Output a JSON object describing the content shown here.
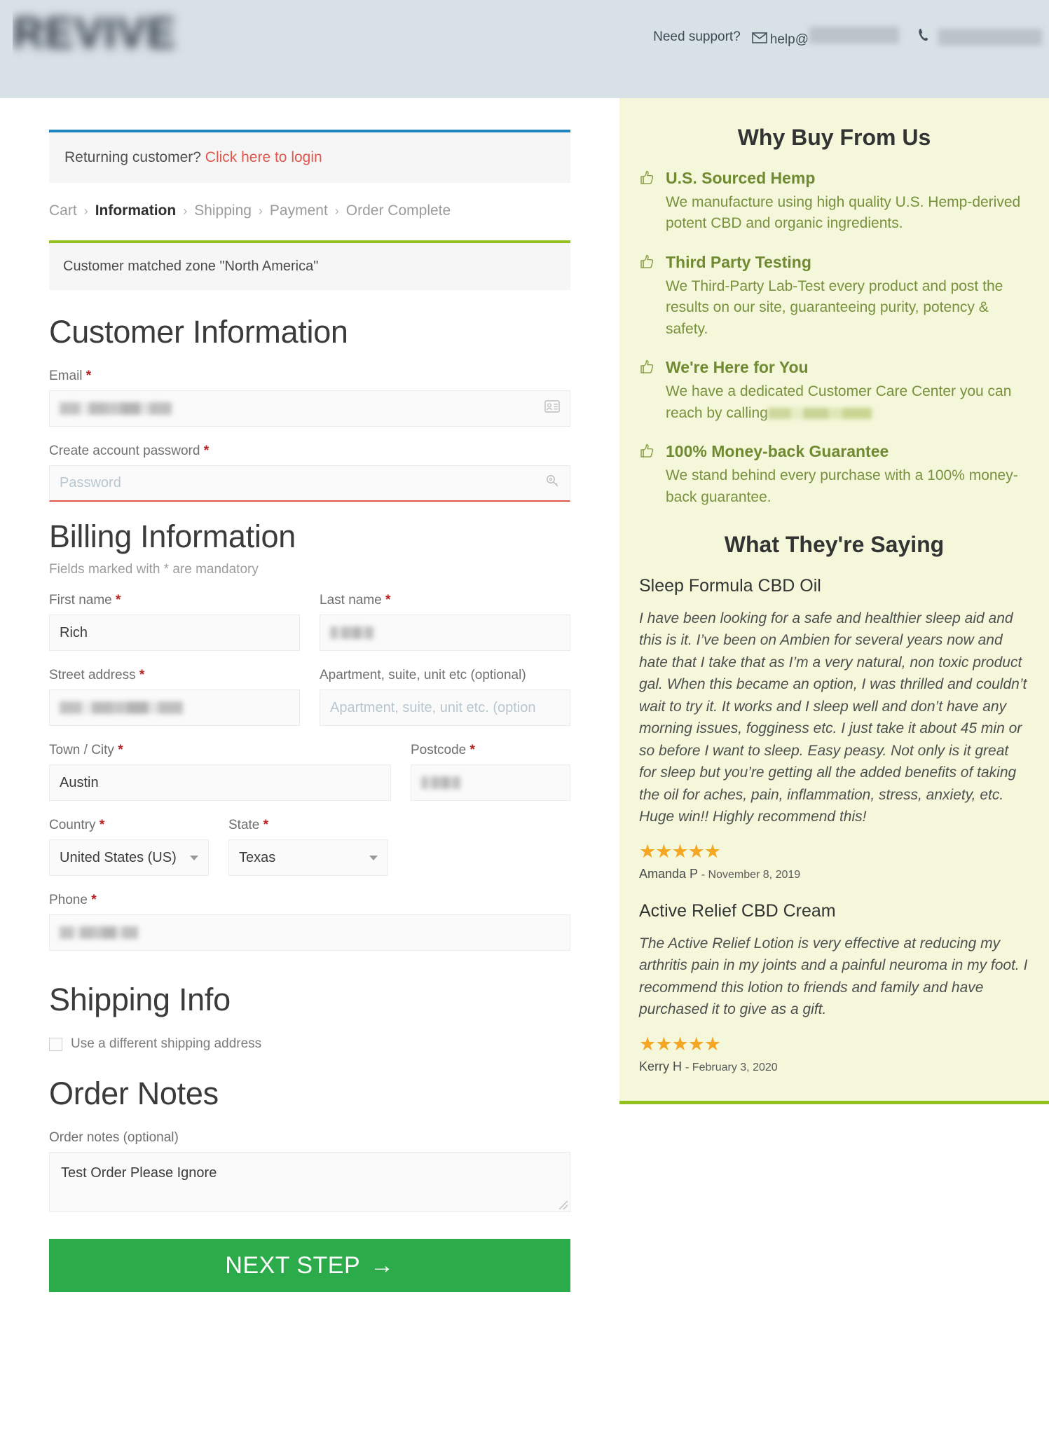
{
  "header": {
    "logo_alt": "brand-logo-redacted",
    "support_label": "Need support?",
    "email_prefix": "help@",
    "email_redacted": true,
    "phone_redacted": true,
    "mail_icon": "envelope-icon",
    "phone_icon": "phone-icon"
  },
  "login_notice": {
    "text": "Returning customer?",
    "link": "Click here to login"
  },
  "breadcrumb": {
    "items": [
      {
        "label": "Cart",
        "active": false
      },
      {
        "label": "Information",
        "active": true
      },
      {
        "label": "Shipping",
        "active": false
      },
      {
        "label": "Payment",
        "active": false
      },
      {
        "label": "Order Complete",
        "active": false
      }
    ],
    "separator": "›"
  },
  "zone_notice": "Customer matched zone \"North America\"",
  "customer": {
    "heading": "Customer Information",
    "email_label": "Email",
    "email_value_redacted": true,
    "email_icon": "contact-card-icon",
    "password_label": "Create account password",
    "password_placeholder": "Password",
    "password_icon": "key-icon"
  },
  "billing": {
    "heading": "Billing Information",
    "mandatory_note": "Fields marked with * are mandatory",
    "first_name_label": "First name",
    "first_name_value": "Rich",
    "last_name_label": "Last name",
    "last_name_redacted": true,
    "street_label": "Street address",
    "street_redacted": true,
    "apartment_label": "Apartment, suite, unit etc (optional)",
    "apartment_placeholder": "Apartment, suite, unit etc. (option",
    "city_label": "Town / City",
    "city_value": "Austin",
    "postcode_label": "Postcode",
    "postcode_redacted": true,
    "country_label": "Country",
    "country_value": "United States (US)",
    "state_label": "State",
    "state_value": "Texas",
    "phone_label": "Phone",
    "phone_redacted": true,
    "required_marker": "*"
  },
  "shipping": {
    "heading": "Shipping Info",
    "different_address_label": "Use a different shipping address",
    "checked": false
  },
  "order_notes": {
    "heading": "Order Notes",
    "label": "Order notes (optional)",
    "value": "Test Order Please Ignore"
  },
  "submit": {
    "label": "NEXT STEP",
    "arrow": "→",
    "color": "#2cab4a"
  },
  "sidebar": {
    "why_buy_heading": "Why Buy From Us",
    "benefits": [
      {
        "title": "U.S. Sourced Hemp",
        "body": "We manufacture using high quality U.S. Hemp-derived potent CBD and organic ingredients.",
        "icon": "thumbs-up-icon"
      },
      {
        "title": "Third Party Testing",
        "body": "We Third-Party Lab-Test every product and post the results on our site, guaranteeing purity, potency & safety.",
        "icon": "thumbs-up-icon"
      },
      {
        "title": "We're Here for You",
        "body_prefix": "We have a dedicated Customer Care Center you can reach by calling",
        "body_redacted": true,
        "icon": "thumbs-up-icon"
      },
      {
        "title": "100% Money-back Guarantee",
        "body": "We stand behind every purchase with a 100% money-back guarantee.",
        "icon": "thumbs-up-icon"
      }
    ],
    "testimonials_heading": "What They're Saying",
    "reviews": [
      {
        "product": "Sleep Formula CBD Oil",
        "text": "I have been looking for a safe and healthier sleep aid and this is it. I’ve been on Ambien for several years now and hate that I take that as I’m a very natural, non toxic product gal. When this became an option, I was thrilled and couldn’t wait to try it. It works and I sleep well and don’t have any morning issues, fogginess etc. I just take it about 45 min or so before I want to sleep. Easy peasy. Not only is it great for sleep but you’re getting all the added benefits of taking the oil for aches, pain, inflammation, stress, anxiety, etc. Huge win!! Highly recommend this!",
        "stars": 5,
        "author": "Amanda P",
        "date": "- November 8, 2019"
      },
      {
        "product": "Active Relief CBD Cream",
        "text": "The Active Relief Lotion is very effective at reducing my arthritis pain in my joints and a painful neuroma in my foot. I recommend this lotion to friends and family and have purchased it to give as a gift.",
        "stars": 5,
        "author": "Kerry H",
        "date": "- February 3, 2020"
      }
    ],
    "star_glyph": "★",
    "accent_color": "#93c01f",
    "background": "#f4f7da"
  }
}
